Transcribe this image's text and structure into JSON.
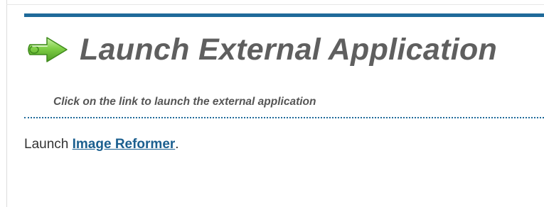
{
  "header": {
    "icon": "right-arrow-icon",
    "title": "Launch External Application"
  },
  "instructions": "Click on the link to launch the external application",
  "launch": {
    "prefix": "Launch",
    "link_label": "Image Reformer",
    "suffix": "."
  },
  "colors": {
    "accent": "#1f6a9a",
    "title": "#5f5f5f",
    "link": "#1b5f8f",
    "icon_green": "#6cbf3a"
  }
}
